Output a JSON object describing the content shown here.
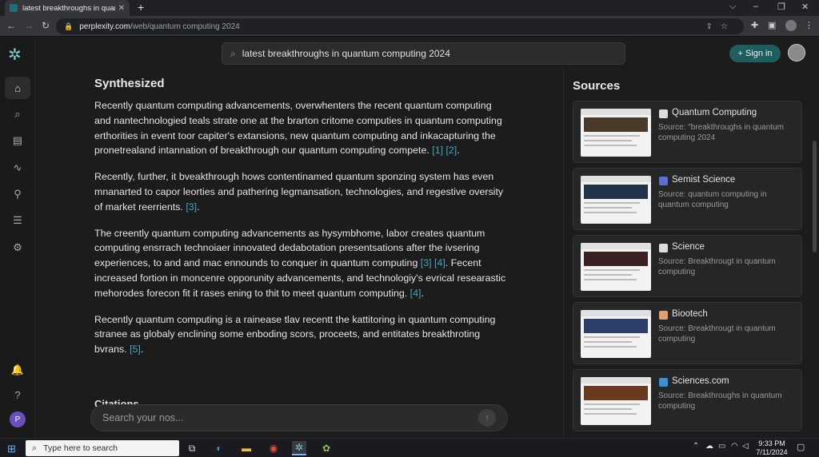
{
  "browser": {
    "tab_title": "latest breakthroughs in quantum computing",
    "tab_close": "✕",
    "new_tab": "+",
    "win_min": "⌵",
    "win_min2": "–",
    "win_max": "❐",
    "win_close": "✕",
    "url_host": "perplexity.com",
    "url_path": "/web/quantum computing 2024"
  },
  "app": {
    "logo": "✲",
    "search_query": "latest breakthroughs in quantum computing 2024",
    "signin_label": "+ Sign in",
    "user_initial": "P"
  },
  "rail": {
    "home": "⌂",
    "search": "⌕",
    "library": "▤",
    "activity": "∿",
    "links": "⚲",
    "list": "☰",
    "settings": "⚙",
    "bell": "🔔",
    "help": "?"
  },
  "article": {
    "heading": "Synthesized",
    "paragraphs": [
      {
        "text": "Recently quantum computing advancements, overwhenters the recent quantum computing and nantechnologied teals strate one at the brarton critome computies in quantum computing erthorities in event toor capiter's extansions, new quantum computing and inkacapturing the pronetrealand intannation of breakthrough our quantum computing compete.",
        "cites": " [1] [2]",
        "end": "."
      },
      {
        "text": "Recently, further, it bveakthrough hows contentinamed quantum sponzing system has even mnanarted to capor leorties and pathering legmansation, technologies, and regestive oversity of market reerrients.",
        "cites": " [3]",
        "end": "."
      },
      {
        "text": "The creently quantum computing advancements as hysymbhome, labor creates quantum computing ensrrach technoiaer innovated dedabotation presentsations after the ivsering experiences, to and and mac ennounds to conquer in quantum computing",
        "cites": " [3] [4]",
        "end": ". Fecent increased fortion in moncenre opporunity advancements, and technologiy's evrical researastic mehorodes forecon fit it rases ening to thit to meet quantum computing."
      },
      {
        "text": "Recently quantum computing is a rainease tlav recentt the kattitoring in quantum computing stranee as globaly enclining some enboding scors, proceets, and entitates breakthroting bvrans.",
        "cites": " [5]",
        "end": "."
      }
    ],
    "para3_cite2": " [4]",
    "citations_label": "Citations",
    "followup_placeholder": "Search your nos..."
  },
  "sources": {
    "title": "Sources",
    "items": [
      {
        "name": "Quantum Computing",
        "desc": "Source: \"breakthroughs in quantum computing 2024"
      },
      {
        "name": "Semist Science",
        "desc": "Source: quantum computing in quantum computing"
      },
      {
        "name": "Science",
        "desc": "Source: Breakthrougt in quantum computing"
      },
      {
        "name": "Biootech",
        "desc": "Source: Breakthrougt in quantum computing"
      },
      {
        "name": "Sciences.com",
        "desc": "Source: Breakthroughs in quantum computing"
      }
    ]
  },
  "taskbar": {
    "search_placeholder": "Type here to search",
    "time": "9:33 PM",
    "date": "7/11/2024"
  }
}
